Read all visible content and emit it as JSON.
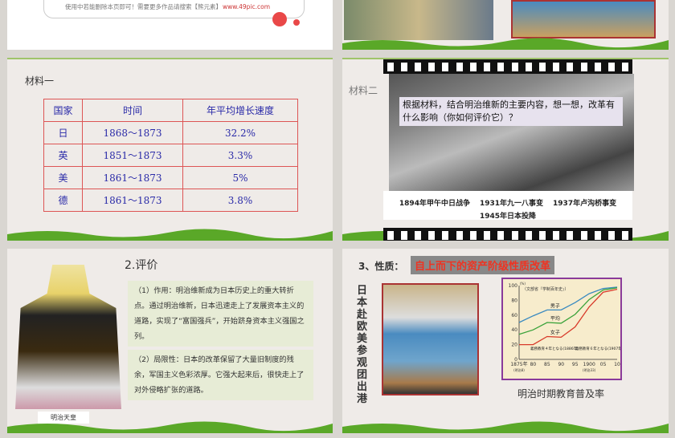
{
  "slide1": {
    "note": "使用中若能删除本页即可！需要更多作品请搜索【熊元素】",
    "url": "www.49pic.com"
  },
  "slide3": {
    "label": "材料一",
    "headers": [
      "国家",
      "时间",
      "年平均增长速度"
    ],
    "rows": [
      [
        "日",
        "1868～1873",
        "32.2%"
      ],
      [
        "英",
        "1851～1873",
        "3.3%"
      ],
      [
        "美",
        "1861～1873",
        "5%"
      ],
      [
        "德",
        "1861～1873",
        "3.8%"
      ]
    ]
  },
  "slide4": {
    "label": "材料二",
    "question": "根据材料，结合明治维新的主要内容，想一想，改革有什么影响（你如何评价它）？",
    "events": [
      "1894年甲午中日战争",
      "1931年九一八事变",
      "1937年卢沟桥事变",
      "1945年日本投降"
    ]
  },
  "slide5": {
    "title": "2.评价",
    "caption": "明治天皇",
    "p1": "（1）作用：明治维新成为日本历史上的重大转折点。通过明治维新，日本迅速走上了发展资本主义的道路，实现了“富国强兵”，开始跻身资本主义强国之列。",
    "p2": "（2）局限性：日本的改革保留了大量旧制度的残余，军国主义色彩浓厚。它强大起来后，很快走上了对外侵略扩张的道路。"
  },
  "slide6": {
    "prefix": "3、性质：",
    "nature": "自上而下的资产阶级性质改革",
    "vertical": "日本赴欧美参观团出港",
    "chart_caption": "明治时期教育普及率"
  },
  "chart_data": {
    "type": "line",
    "source": "（文部省『学制百年史』）",
    "ylabel": "(%)",
    "ylim": [
      0,
      100
    ],
    "yticks": [
      0,
      20,
      40,
      60,
      80,
      100
    ],
    "xticks": [
      "1875年",
      "80",
      "85",
      "90",
      "95",
      "1900",
      "05",
      "10"
    ],
    "xsub": [
      "(明治8)",
      "(明治33)"
    ],
    "x": [
      1875,
      1880,
      1885,
      1890,
      1895,
      1900,
      1905,
      1910
    ],
    "series": [
      {
        "name": "男子",
        "color": "#3a8ac0",
        "values": [
          50,
          59,
          67,
          67,
          77,
          89,
          96,
          98
        ]
      },
      {
        "name": "平均",
        "color": "#3aa23a",
        "values": [
          34,
          40,
          50,
          49,
          61,
          81,
          94,
          97
        ]
      },
      {
        "name": "女子",
        "color": "#d83a2a",
        "values": [
          20,
          20,
          31,
          30,
          44,
          71,
          91,
          95
        ]
      }
    ],
    "annotations": [
      "義務教育４年となる(1886年)",
      "義務教育６年となる(1907年)"
    ]
  }
}
